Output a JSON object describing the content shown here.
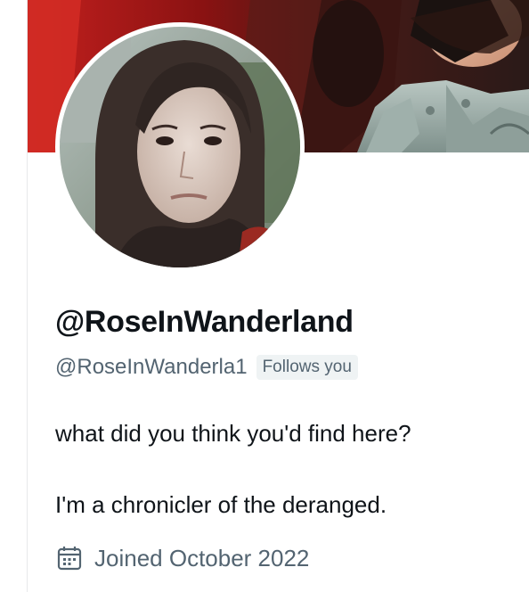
{
  "profile": {
    "display_name": "@RoseInWanderland",
    "handle": "@RoseInWanderla1",
    "follows_badge": "Follows you",
    "bio": {
      "line1": "what did you think you'd find here?",
      "line2": "I'm a chronicler of the deranged."
    },
    "joined": "Joined October 2022"
  },
  "icons": {
    "joined": "calendar-icon"
  },
  "colors": {
    "primary_text": "#0f1419",
    "secondary_text": "#536471",
    "badge_bg": "#eff3f4",
    "divider": "#e7e9ea"
  }
}
